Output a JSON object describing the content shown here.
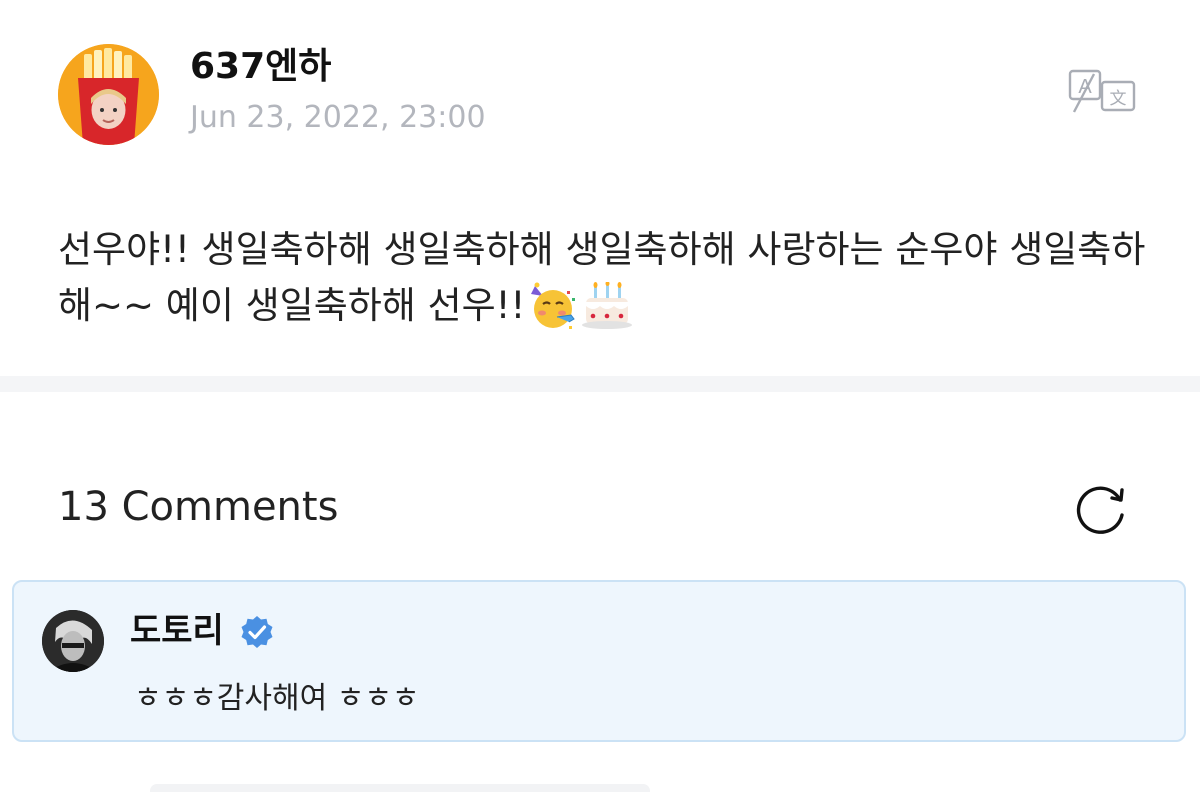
{
  "post": {
    "author": "637엔하",
    "date": "Jun 23, 2022, 23:00",
    "body": "선우야!! 생일축하해 생일축하해 생일축하해 사랑하는 순우야 생일축하해~~ 예이 생일축하해 선우!!",
    "emojis": [
      "partying-face",
      "birthday-cake"
    ],
    "avatar_icon": "french-fries-costume-avatar",
    "translate_icon": "translate-icon"
  },
  "comments": {
    "count_label": "13 Comments",
    "refresh_icon": "refresh-icon",
    "items": [
      {
        "author": "도토리",
        "verified": true,
        "text": "ㅎㅎㅎ감사해여 ㅎㅎㅎ",
        "highlighted": true,
        "avatar_icon": "artist-avatar"
      }
    ]
  },
  "colors": {
    "date_gray": "#b3b6bd",
    "verified_blue": "#4a90e2",
    "highlight_bg": "#eef6fd",
    "highlight_border": "#cbe2f5",
    "divider": "#f4f5f7",
    "avatar_orange": "#f6a51d"
  }
}
